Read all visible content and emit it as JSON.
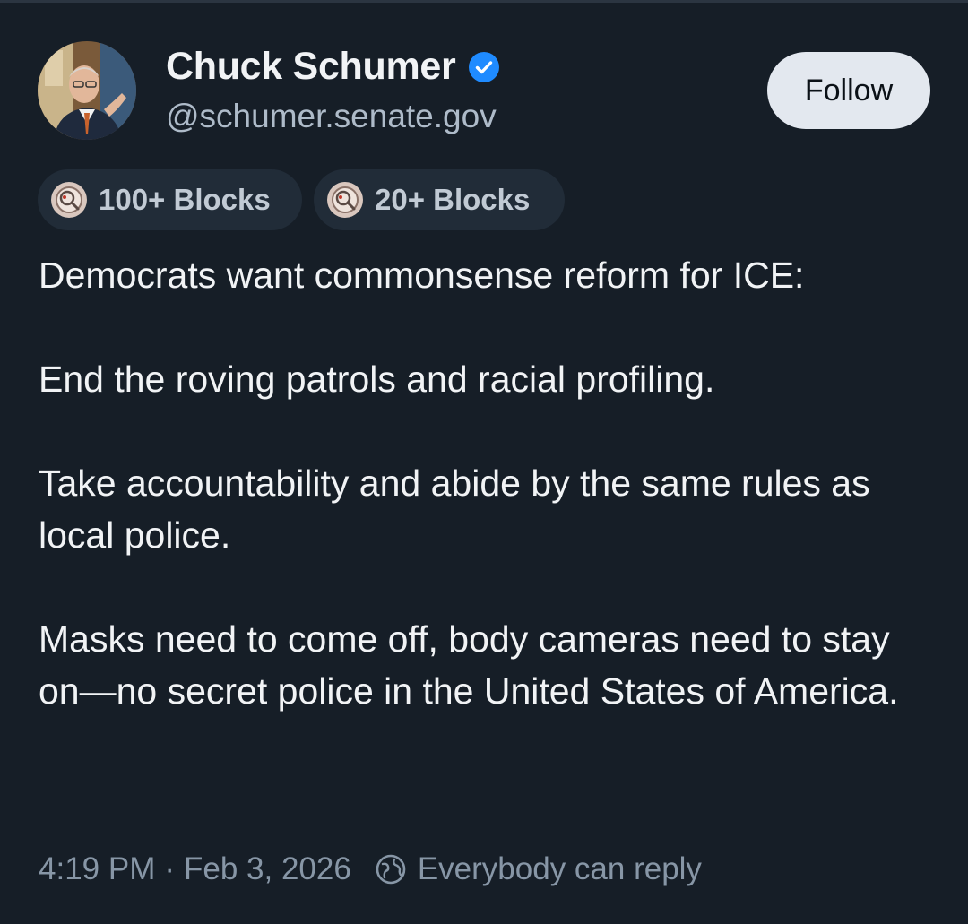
{
  "author": {
    "display_name": "Chuck Schumer",
    "handle": "@schumer.senate.gov",
    "verified": true
  },
  "follow_button": {
    "label": "Follow"
  },
  "badges": [
    {
      "label": "100+ Blocks"
    },
    {
      "label": "20+ Blocks"
    }
  ],
  "post": {
    "paragraphs": [
      "Democrats want commonsense reform for ICE:",
      "End the roving patrols and racial profiling.",
      "Take accountability and abide by the same rules as local police.",
      "Masks need to come off, body cameras need to stay on—no secret police in the United States of America."
    ]
  },
  "footer": {
    "time": "4:19 PM",
    "separator": "·",
    "date": "Feb 3, 2026",
    "reply_setting": "Everybody can reply"
  },
  "colors": {
    "background": "#161e27",
    "verified_badge": "#1f8bff",
    "follow_button_bg": "#e3e8ef",
    "badge_bg": "#212c38",
    "muted_text": "#8796a6"
  },
  "icons": {
    "verified": "verified-check-icon",
    "badge": "blocks-badge-icon",
    "reply_setting": "globe-icon"
  }
}
